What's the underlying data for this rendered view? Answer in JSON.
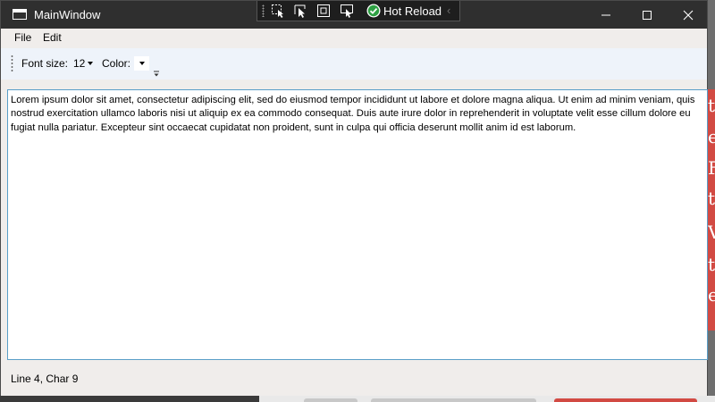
{
  "window": {
    "title": "MainWindow"
  },
  "debug_toolbar": {
    "buttons": [
      "select-element-icon",
      "display-layout-adorners-icon",
      "track-focused-element-icon",
      "toggle-selection-icon"
    ],
    "hot_reload_label": "Hot Reload",
    "hot_reload_icon": "check-circle-icon",
    "collapse_glyph": "‹",
    "accent": "#2ea043"
  },
  "caption_buttons": [
    "minimize-icon",
    "maximize-icon",
    "close-icon"
  ],
  "menu": {
    "items": [
      "File",
      "Edit"
    ]
  },
  "toolbar": {
    "font_size_label": "Font size:",
    "font_size_value": "12",
    "color_label": "Color:",
    "color_value": "#ffffff"
  },
  "editor": {
    "text": "Lorem ipsum dolor sit amet, consectetur adipiscing elit, sed do eiusmod tempor incididunt ut labore et dolore magna aliqua. Ut enim ad minim veniam, quis nostrud exercitation ullamco laboris nisi ut aliquip ex ea commodo consequat. Duis aute irure dolor in reprehenderit in voluptate velit esse cillum dolore eu fugiat nulla pariatur. Excepteur sint occaecat cupidatat non proident, sunt in culpa qui officia deserunt mollit anim id est laborum."
  },
  "status": {
    "text": "Line 4, Char 9"
  },
  "colors": {
    "titlebar": "#2f2f2f",
    "toolbar": "#eef3fa",
    "editor_border": "#5a9ec8",
    "background_accent": "#d24a43"
  }
}
